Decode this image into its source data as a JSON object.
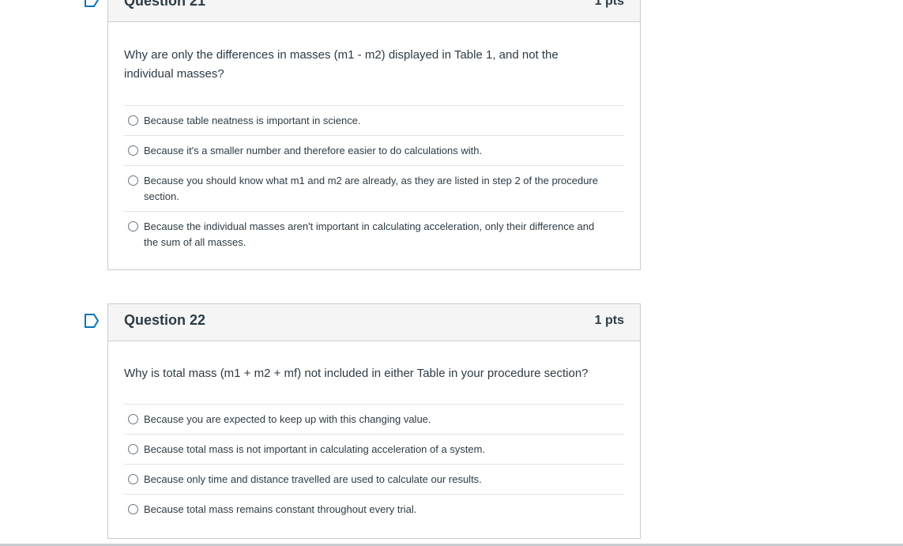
{
  "questions": [
    {
      "name": "Question 21",
      "points": "1 pts",
      "text": "Why are only the differences in masses (m1 - m2) displayed in Table 1, and not the individual masses?",
      "answers": [
        "Because table neatness is important in science.",
        "Because it's a smaller number and therefore easier to do calculations with.",
        "Because you should know what m1 and m2 are already, as they are listed in step 2 of the procedure section.",
        "Because the individual masses aren't important in calculating acceleration, only their difference and the sum of all masses."
      ]
    },
    {
      "name": "Question 22",
      "points": "1 pts",
      "text": "Why is total mass (m1 + m2 + mf) not included in either Table in your procedure section?",
      "answers": [
        "Because you are expected to keep up with this changing value.",
        "Because total mass is not important in calculating acceleration of a system.",
        "Because only time and distance travelled are used to calculate our results.",
        "Because total mass remains constant throughout every trial."
      ]
    }
  ],
  "colors": {
    "flag": "#0374b5",
    "border": "#c7cdd1",
    "header_bg": "#f5f5f5",
    "text": "#2d3b45"
  },
  "icons": {
    "flag": "flag-question-icon",
    "radio": "radio-button-icon"
  }
}
